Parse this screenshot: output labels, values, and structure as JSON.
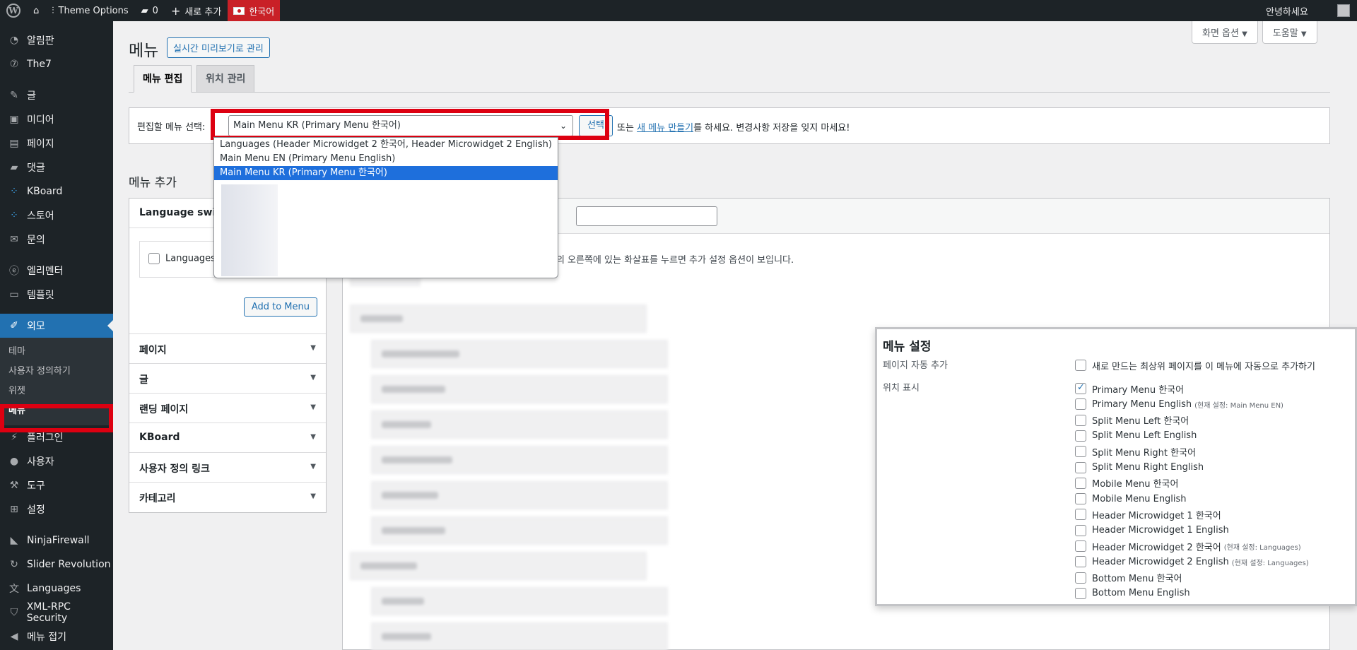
{
  "adminbar": {
    "site": "The7",
    "theme_options": "Theme Options",
    "comments_count": "0",
    "new": "새로 추가",
    "language": "한국어",
    "greeting": "안녕하세요"
  },
  "sidebar": {
    "items": [
      {
        "label": "알림판",
        "icon": "dashboard-icon"
      },
      {
        "label": "The7",
        "icon": "the7-icon"
      },
      {
        "label": "글",
        "icon": "pin-icon"
      },
      {
        "label": "미디어",
        "icon": "media-icon"
      },
      {
        "label": "페이지",
        "icon": "page-icon"
      },
      {
        "label": "댓글",
        "icon": "comment-icon"
      },
      {
        "label": "KBoard",
        "icon": "kboard-icon"
      },
      {
        "label": "스토어",
        "icon": "store-icon"
      },
      {
        "label": "문의",
        "icon": "mail-icon"
      },
      {
        "label": "엘리멘터",
        "icon": "elementor-icon"
      },
      {
        "label": "템플릿",
        "icon": "folder-icon"
      },
      {
        "label": "외모",
        "icon": "brush-icon"
      }
    ],
    "submenu": [
      "테마",
      "사용자 정의하기",
      "위젯",
      "메뉴"
    ],
    "items_after": [
      {
        "label": "플러그인",
        "icon": "plugin-icon"
      },
      {
        "label": "사용자",
        "icon": "user-icon"
      },
      {
        "label": "도구",
        "icon": "wrench-icon"
      },
      {
        "label": "설정",
        "icon": "settings-icon"
      },
      {
        "label": "NinjaFirewall",
        "icon": "ninja-icon"
      },
      {
        "label": "Slider Revolution",
        "icon": "slider-icon"
      },
      {
        "label": "Languages",
        "icon": "languages-icon"
      },
      {
        "label": "XML-RPC Security",
        "icon": "shield-icon"
      },
      {
        "label": "메뉴 접기",
        "icon": "collapse-icon"
      }
    ]
  },
  "screen_options": {
    "screen": "화면 옵션",
    "help": "도움말"
  },
  "page": {
    "title": "메뉴",
    "live_preview": "실시간 미리보기로 관리",
    "tabs": [
      "메뉴 편집",
      "위치 관리"
    ]
  },
  "manage": {
    "label": "편집할 메뉴 선택:",
    "selected": "Main Menu KR (Primary Menu 한국어)",
    "select_button": "선택",
    "or_text": "또는",
    "create_link": "새 메뉴 만들기",
    "rest": "를 하세요. 변경사항 저장을 잊지 마세요!"
  },
  "dropdown": {
    "options": [
      "Languages (Header Microwidget 2 한국어, Header Microwidget 2 English)",
      "Main Menu EN (Primary Menu English)",
      "Main Menu KR (Primary Menu 한국어)"
    ]
  },
  "add_items": {
    "title": "메뉴 추가",
    "language_switcher": "Language switch",
    "languages_checkbox": "Languages",
    "add_button": "Add to Menu",
    "sections": [
      "페이지",
      "글",
      "랜딩 페이지",
      "KBoard",
      "사용자 정의 링크",
      "카테고리"
    ]
  },
  "edit": {
    "description": "점의 오른쪽에 있는 화살표를 누르면 추가 설정 옵션이 보입니다."
  },
  "menu_settings": {
    "title": "메뉴 설정",
    "auto_add_label": "페이지 자동 추가",
    "auto_add_option": "새로 만드는 최상위 페이지를 이 메뉴에 자동으로 추가하기",
    "display_label": "위치 표시",
    "locations": [
      {
        "label": "Primary Menu 한국어",
        "checked": true,
        "note": ""
      },
      {
        "label": "Primary Menu English",
        "checked": false,
        "note": "(현재 설정: Main Menu EN)"
      },
      {
        "label": "Split Menu Left 한국어",
        "checked": false,
        "note": ""
      },
      {
        "label": "Split Menu Left English",
        "checked": false,
        "note": ""
      },
      {
        "label": "Split Menu Right 한국어",
        "checked": false,
        "note": ""
      },
      {
        "label": "Split Menu Right English",
        "checked": false,
        "note": ""
      },
      {
        "label": "Mobile Menu 한국어",
        "checked": false,
        "note": ""
      },
      {
        "label": "Mobile Menu English",
        "checked": false,
        "note": ""
      },
      {
        "label": "Header Microwidget 1 한국어",
        "checked": false,
        "note": ""
      },
      {
        "label": "Header Microwidget 1 English",
        "checked": false,
        "note": ""
      },
      {
        "label": "Header Microwidget 2 한국어",
        "checked": false,
        "note": "(현재 설정: Languages)"
      },
      {
        "label": "Header Microwidget 2 English",
        "checked": false,
        "note": "(현재 설정: Languages)"
      },
      {
        "label": "Bottom Menu 한국어",
        "checked": false,
        "note": ""
      },
      {
        "label": "Bottom Menu English",
        "checked": false,
        "note": ""
      }
    ]
  },
  "colors": {
    "admin_dark": "#1d2327",
    "accent": "#2271b1",
    "highlight_red": "#dd0011",
    "lang_red": "#c92027"
  }
}
